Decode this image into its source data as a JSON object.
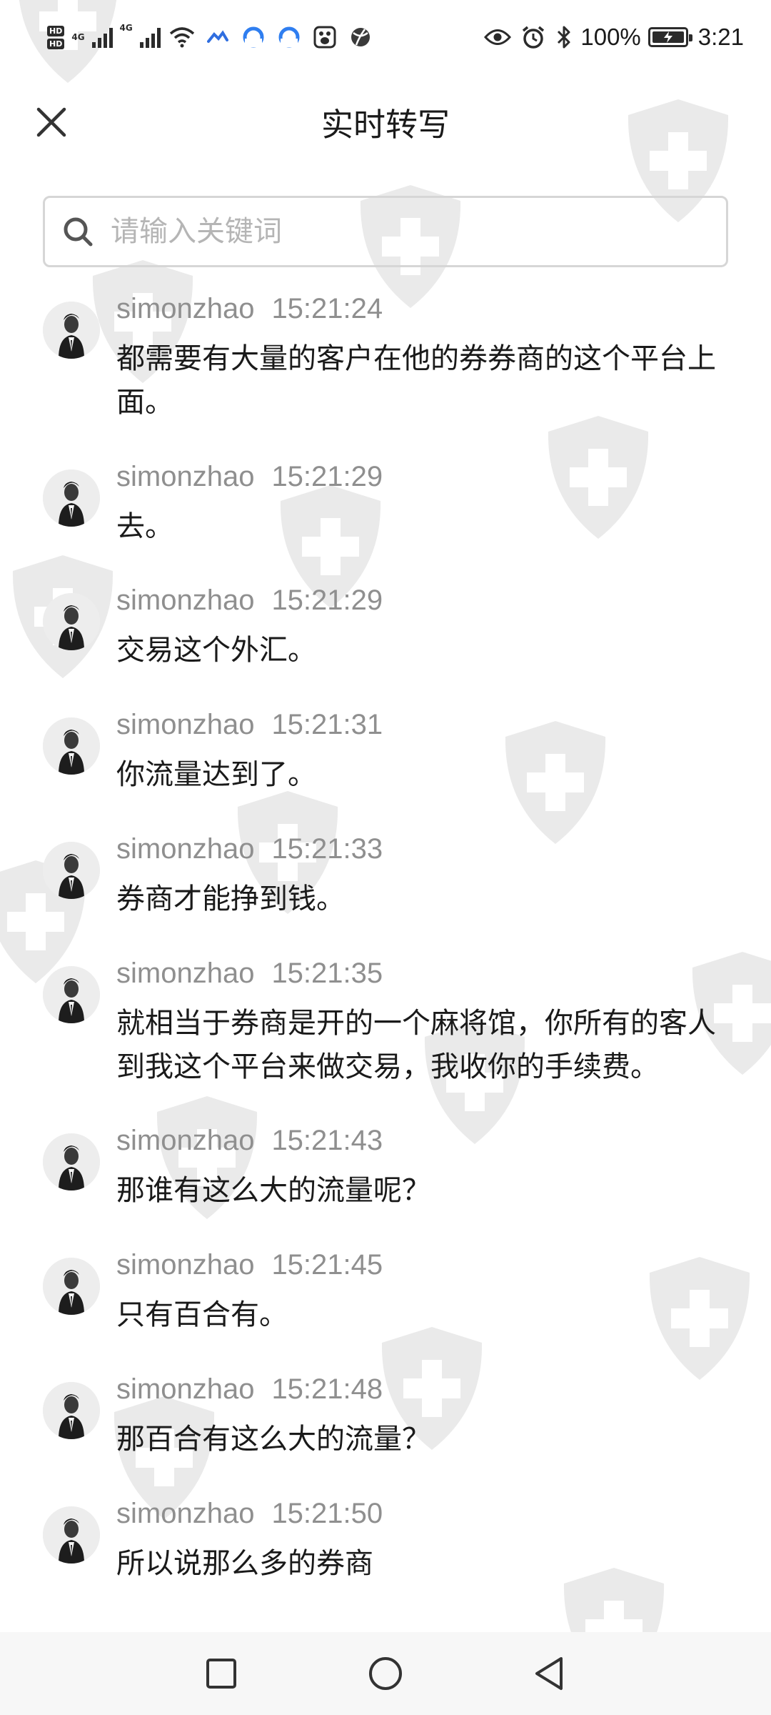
{
  "status_bar": {
    "hd_label": "HD",
    "network_label": "4G",
    "battery_text": "100%",
    "battery_level": 1.0,
    "time": "3:21"
  },
  "header": {
    "title": "实时转写",
    "close_icon": "close-icon"
  },
  "search": {
    "placeholder": "请输入关键词",
    "value": ""
  },
  "entries": [
    {
      "speaker": "simonzhao",
      "time": "15:21:24",
      "text": "都需要有大量的客户在他的券券商的这个平台上面。"
    },
    {
      "speaker": "simonzhao",
      "time": "15:21:29",
      "text": "去。"
    },
    {
      "speaker": "simonzhao",
      "time": "15:21:29",
      "text": "交易这个外汇。"
    },
    {
      "speaker": "simonzhao",
      "time": "15:21:31",
      "text": "你流量达到了。"
    },
    {
      "speaker": "simonzhao",
      "time": "15:21:33",
      "text": "券商才能挣到钱。"
    },
    {
      "speaker": "simonzhao",
      "time": "15:21:35",
      "text": "就相当于券商是开的一个麻将馆，你所有的客人到我这个平台来做交易，我收你的手续费。"
    },
    {
      "speaker": "simonzhao",
      "time": "15:21:43",
      "text": "那谁有这么大的流量呢？"
    },
    {
      "speaker": "simonzhao",
      "time": "15:21:45",
      "text": "只有百合有。"
    },
    {
      "speaker": "simonzhao",
      "time": "15:21:48",
      "text": "那百合有这么大的流量？"
    },
    {
      "speaker": "simonzhao",
      "time": "15:21:50",
      "text": "所以说那么多的券商"
    }
  ],
  "navbar": {
    "icons": [
      "recent-apps-icon",
      "home-icon",
      "back-icon"
    ]
  },
  "colors": {
    "meta_text": "#8f8f8f",
    "body_text": "#1a1a1a",
    "search_border": "#d6d6d6",
    "watermark": "#d9d9d9"
  }
}
